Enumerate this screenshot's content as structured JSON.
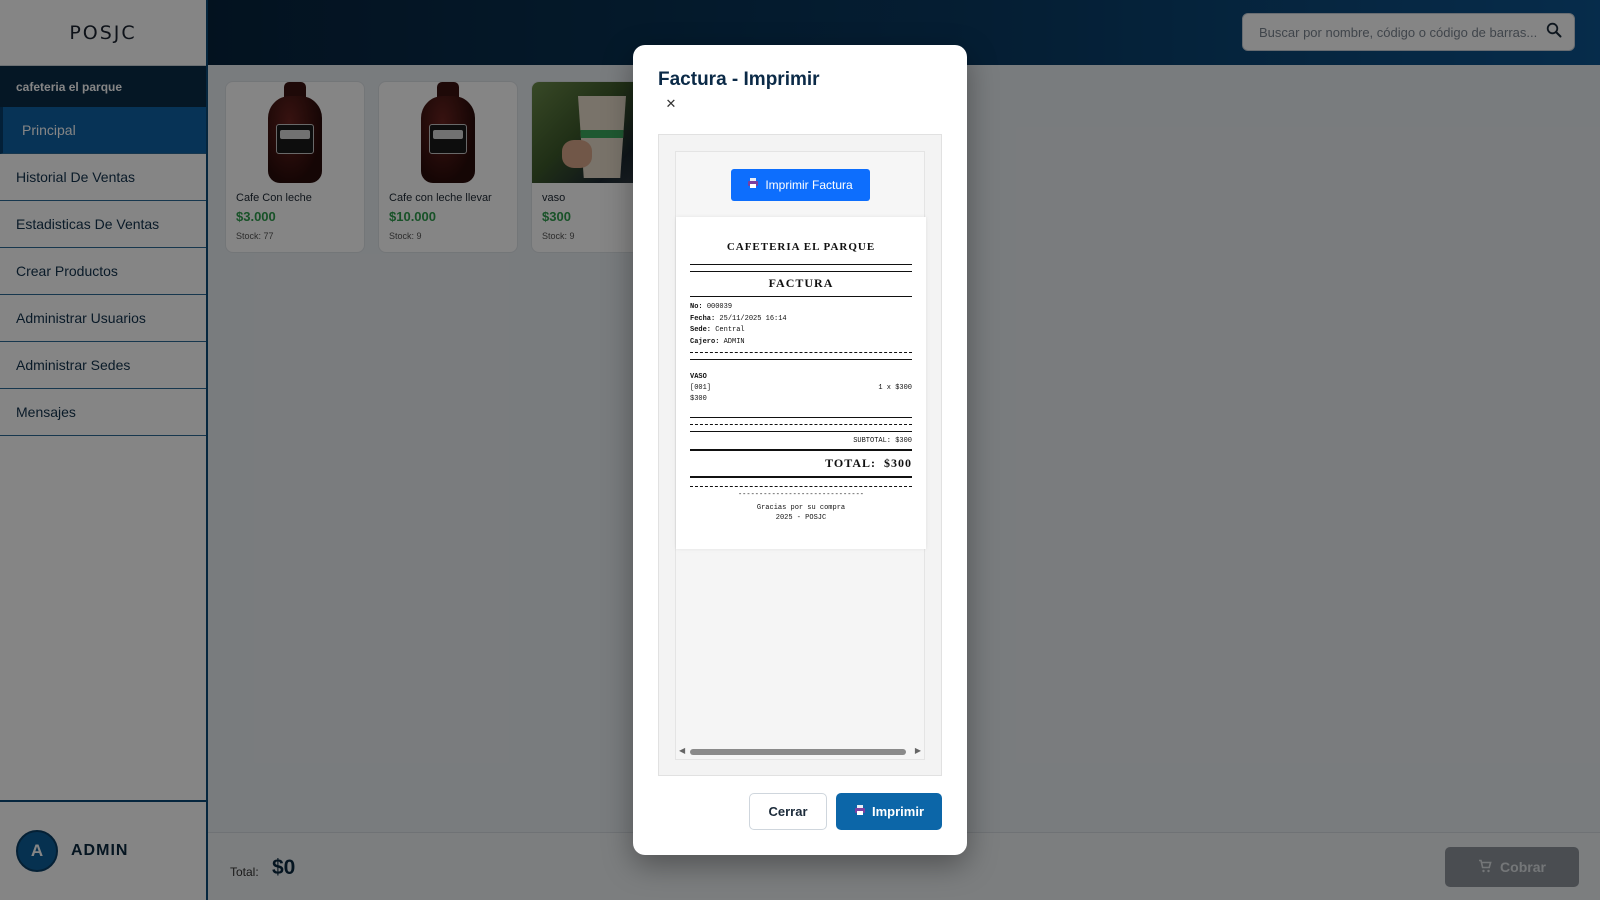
{
  "app": {
    "logo": "POSJC"
  },
  "sidebar": {
    "store": "cafeteria el parque",
    "items": [
      {
        "label": "Principal",
        "active": true
      },
      {
        "label": "Historial De Ventas"
      },
      {
        "label": "Estadisticas De Ventas"
      },
      {
        "label": "Crear Productos"
      },
      {
        "label": "Administrar Usuarios"
      },
      {
        "label": "Administrar Sedes"
      },
      {
        "label": "Mensajes"
      }
    ],
    "user": {
      "initial": "A",
      "name": "ADMIN"
    }
  },
  "header": {
    "search": {
      "placeholder": "Buscar por nombre, código o código de barras...",
      "icon": "search-icon"
    }
  },
  "products": [
    {
      "name": "Cafe Con leche",
      "price": "$3.000",
      "stock": "Stock: 77",
      "image": "chocolate-syrup-bottle"
    },
    {
      "name": "Cafe con leche llevar",
      "price": "$10.000",
      "stock": "Stock: 9",
      "image": "chocolate-syrup-bottle"
    },
    {
      "name": "vaso",
      "price": "$300",
      "stock": "Stock: 9",
      "image": "paper-cup-photo"
    }
  ],
  "footer": {
    "total_label": "Total:",
    "total_value": "$0",
    "charge_label": "Cobrar",
    "charge_icon": "cart-icon"
  },
  "modal": {
    "title": "Factura - Imprimir",
    "close_icon": "close-icon",
    "print_invoice_label": "Imprimir Factura",
    "receipt": {
      "business": "CAFETERIA EL PARQUE",
      "doc_type": "FACTURA",
      "meta": [
        {
          "key": "No:",
          "value": "000039"
        },
        {
          "key": "Fecha:",
          "value": "25/11/2025 16:14"
        },
        {
          "key": "Sede:",
          "value": "Central"
        },
        {
          "key": "Cajero:",
          "value": "ADMIN"
        }
      ],
      "item": {
        "name": "VASO",
        "code": "[001]",
        "qty": "1 x $300",
        "amount": "$300"
      },
      "subtotal": "SUBTOTAL: $300",
      "total_label": "TOTAL:",
      "total_value": "$300",
      "separator": "------------------------------",
      "thanks": "Gracias por su compra",
      "credit": "2025 - POSJC"
    },
    "buttons": {
      "close": "Cerrar",
      "print": "Imprimir"
    },
    "colors": {
      "primary": "#0c66a8",
      "print_invoice": "#0d6efd"
    }
  }
}
